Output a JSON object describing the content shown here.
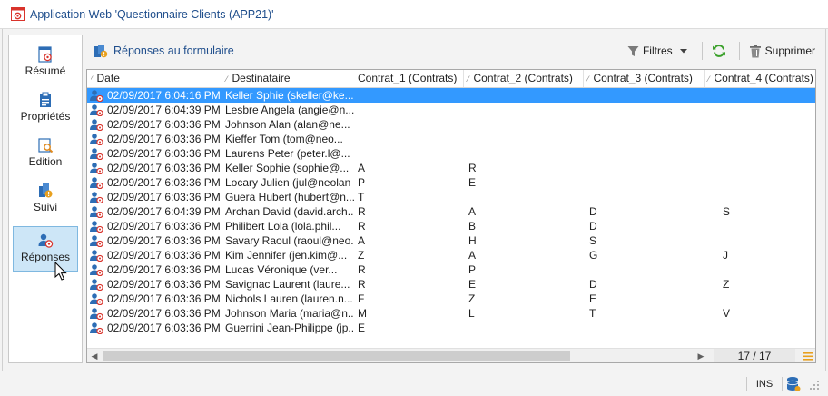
{
  "window": {
    "title": "Application Web 'Questionnaire Clients (APP21)'"
  },
  "sidebar": {
    "items": [
      {
        "label": "Résumé",
        "icon": "summary-icon"
      },
      {
        "label": "Propriétés",
        "icon": "properties-icon"
      },
      {
        "label": "Edition",
        "icon": "edit-icon"
      },
      {
        "label": "Suivi",
        "icon": "tracking-icon"
      },
      {
        "label": "Réponses",
        "icon": "responses-icon",
        "active": true
      }
    ]
  },
  "toolbar": {
    "title": "Réponses au formulaire",
    "filters_label": "Filtres",
    "delete_label": "Supprimer"
  },
  "grid": {
    "columns": [
      "Date",
      "Destinataire",
      "Contrat_1 (Contrats)",
      "Contrat_2 (Contrats)",
      "Contrat_3 (Contrats)",
      "Contrat_4 (Contrats)"
    ],
    "rows": [
      {
        "date": "02/09/2017 6:04:16 PM",
        "dest": "Keller Sphie (skeller@ke...",
        "c1": "",
        "c2": "",
        "c3": "",
        "c4": "",
        "selected": true
      },
      {
        "date": "02/09/2017 6:04:39 PM",
        "dest": "Lesbre Angela (angie@n...",
        "c1": "",
        "c2": "",
        "c3": "",
        "c4": ""
      },
      {
        "date": "02/09/2017 6:03:36 PM",
        "dest": "Johnson Alan (alan@ne...",
        "c1": "",
        "c2": "",
        "c3": "",
        "c4": ""
      },
      {
        "date": "02/09/2017 6:03:36 PM",
        "dest": "Kieffer Tom (tom@neo...",
        "c1": "",
        "c2": "",
        "c3": "",
        "c4": ""
      },
      {
        "date": "02/09/2017 6:03:36 PM",
        "dest": "Laurens Peter (peter.l@...",
        "c1": "",
        "c2": "",
        "c3": "",
        "c4": ""
      },
      {
        "date": "02/09/2017 6:03:36 PM",
        "dest": "Keller Sophie (sophie@...",
        "c1": "A",
        "c2": "R",
        "c3": "",
        "c4": ""
      },
      {
        "date": "02/09/2017 6:03:36 PM",
        "dest": "Locary Julien (jul@neolan",
        "c1": "P",
        "c2": "E",
        "c3": "",
        "c4": ""
      },
      {
        "date": "02/09/2017 6:03:36 PM",
        "dest": "Guera Hubert (hubert@n...",
        "c1": "T",
        "c2": "",
        "c3": "",
        "c4": ""
      },
      {
        "date": "02/09/2017 6:04:39 PM",
        "dest": "Archan David (david.arch...",
        "c1": "R",
        "c2": "A",
        "c3": "D",
        "c4": "S"
      },
      {
        "date": "02/09/2017 6:03:36 PM",
        "dest": "Philibert Lola (lola.phil...",
        "c1": "R",
        "c2": "B",
        "c3": "D",
        "c4": ""
      },
      {
        "date": "02/09/2017 6:03:36 PM",
        "dest": "Savary Raoul (raoul@neo...",
        "c1": "A",
        "c2": "H",
        "c3": "S",
        "c4": ""
      },
      {
        "date": "02/09/2017 6:03:36 PM",
        "dest": "Kim Jennifer (jen.kim@...",
        "c1": "Z",
        "c2": "A",
        "c3": "G",
        "c4": "J"
      },
      {
        "date": "02/09/2017 6:03:36 PM",
        "dest": "Lucas Véronique (ver...",
        "c1": "R",
        "c2": "P",
        "c3": "",
        "c4": ""
      },
      {
        "date": "02/09/2017 6:03:36 PM",
        "dest": "Savignac Laurent (laure...",
        "c1": "R",
        "c2": "E",
        "c3": "D",
        "c4": "Z"
      },
      {
        "date": "02/09/2017 6:03:36 PM",
        "dest": "Nichols Lauren (lauren.n...",
        "c1": "F",
        "c2": "Z",
        "c3": "E",
        "c4": ""
      },
      {
        "date": "02/09/2017 6:03:36 PM",
        "dest": "Johnson Maria (maria@n...",
        "c1": "M",
        "c2": "L",
        "c3": "T",
        "c4": "V"
      },
      {
        "date": "02/09/2017 6:03:36 PM",
        "dest": "Guerrini Jean-Philippe (jp...",
        "c1": "E",
        "c2": "",
        "c3": "",
        "c4": ""
      }
    ],
    "count": "17 / 17"
  },
  "status": {
    "ins": "INS"
  },
  "colors": {
    "accent": "#1f4e8c",
    "selection": "#3399ff",
    "brand_red": "#d9332b"
  }
}
